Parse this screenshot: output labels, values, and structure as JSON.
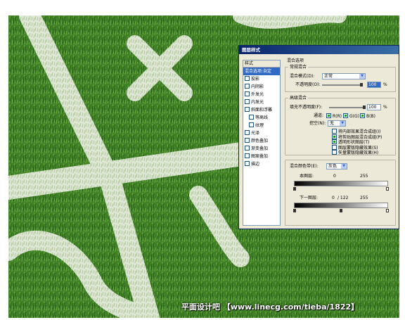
{
  "watermark": "平面设计吧 【www.linecg.com/tieba/1822】",
  "dialog": {
    "title": "图层样式",
    "list_header": "样式",
    "style_items": [
      {
        "label": "混合选项:自定",
        "checkbox": false,
        "checked": false,
        "selected": true,
        "sub": false
      },
      {
        "label": "投影",
        "checkbox": true,
        "checked": false,
        "selected": false,
        "sub": false
      },
      {
        "label": "内阴影",
        "checkbox": true,
        "checked": false,
        "selected": false,
        "sub": false
      },
      {
        "label": "外发光",
        "checkbox": true,
        "checked": false,
        "selected": false,
        "sub": false
      },
      {
        "label": "内发光",
        "checkbox": true,
        "checked": false,
        "selected": false,
        "sub": false
      },
      {
        "label": "斜面和浮雕",
        "checkbox": true,
        "checked": false,
        "selected": false,
        "sub": false
      },
      {
        "label": "等高线",
        "checkbox": true,
        "checked": false,
        "selected": false,
        "sub": true
      },
      {
        "label": "纹理",
        "checkbox": true,
        "checked": false,
        "selected": false,
        "sub": true
      },
      {
        "label": "光泽",
        "checkbox": true,
        "checked": false,
        "selected": false,
        "sub": false
      },
      {
        "label": "颜色叠加",
        "checkbox": true,
        "checked": false,
        "selected": false,
        "sub": false
      },
      {
        "label": "渐变叠加",
        "checkbox": true,
        "checked": false,
        "selected": false,
        "sub": false
      },
      {
        "label": "图案叠加",
        "checkbox": true,
        "checked": false,
        "selected": false,
        "sub": false
      },
      {
        "label": "描边",
        "checkbox": true,
        "checked": false,
        "selected": false,
        "sub": false
      }
    ],
    "blend_options_title": "混合选项",
    "general": {
      "group_label": "常规混合",
      "blend_mode_label": "混合模式(D):",
      "blend_mode_value": "正常",
      "opacity_label": "不透明度(O):",
      "opacity_value": "100",
      "percent": "%"
    },
    "advanced": {
      "group_label": "高级混合",
      "fill_opacity_label": "填充不透明度(F):",
      "fill_opacity_value": "100",
      "percent": "%",
      "channels_label": "通道:",
      "channel_r": "R(R)",
      "channel_g": "G(G)",
      "channel_b": "B(B)",
      "knockout_label": "挖空(N):",
      "knockout_value": "无",
      "options": [
        {
          "label": "将内部效果混合成组(I)",
          "checked": false
        },
        {
          "label": "将剪贴图层混合成组(P)",
          "checked": true
        },
        {
          "label": "透明形状图层(T)",
          "checked": true
        },
        {
          "label": "图层蒙版隐藏效果(S)",
          "checked": false
        },
        {
          "label": "矢量蒙版隐藏效果(H)",
          "checked": false
        }
      ]
    },
    "blend_if": {
      "label": "混合颜色带(E):",
      "value": "灰色",
      "this_layer_label": "本图层:",
      "this_layer_min": "0",
      "this_layer_max": "255",
      "under_layer_label": "下一图层:",
      "under_layer_min": "0",
      "under_layer_split": "/ 122",
      "under_layer_max": "255"
    }
  },
  "colors": {
    "grass": "#3f7f28",
    "title_bar": "#0a246a",
    "dialog_bg": "#ece9d8",
    "selection": "#316ac5"
  }
}
